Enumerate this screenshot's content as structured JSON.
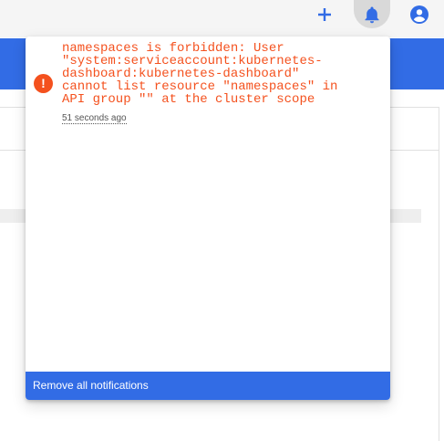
{
  "toolbar": {
    "add_icon": "plus-icon",
    "notifications_icon": "bell-icon",
    "account_icon": "account-circle-icon"
  },
  "notifications": {
    "items": [
      {
        "severity": "error",
        "icon": "error-icon",
        "message": "namespaces is forbidden: User\n\"system:serviceaccount:kubernetes-\ndashboard:kubernetes-dashboard\"\ncannot list resource \"namespaces\" in\nAPI group \"\" at the cluster scope",
        "time": "51 seconds ago"
      }
    ],
    "remove_all_label": "Remove all notifications"
  },
  "colors": {
    "primary": "#326ce5",
    "error": "#f4511e",
    "toolbar_bg": "#f5f5f5"
  }
}
